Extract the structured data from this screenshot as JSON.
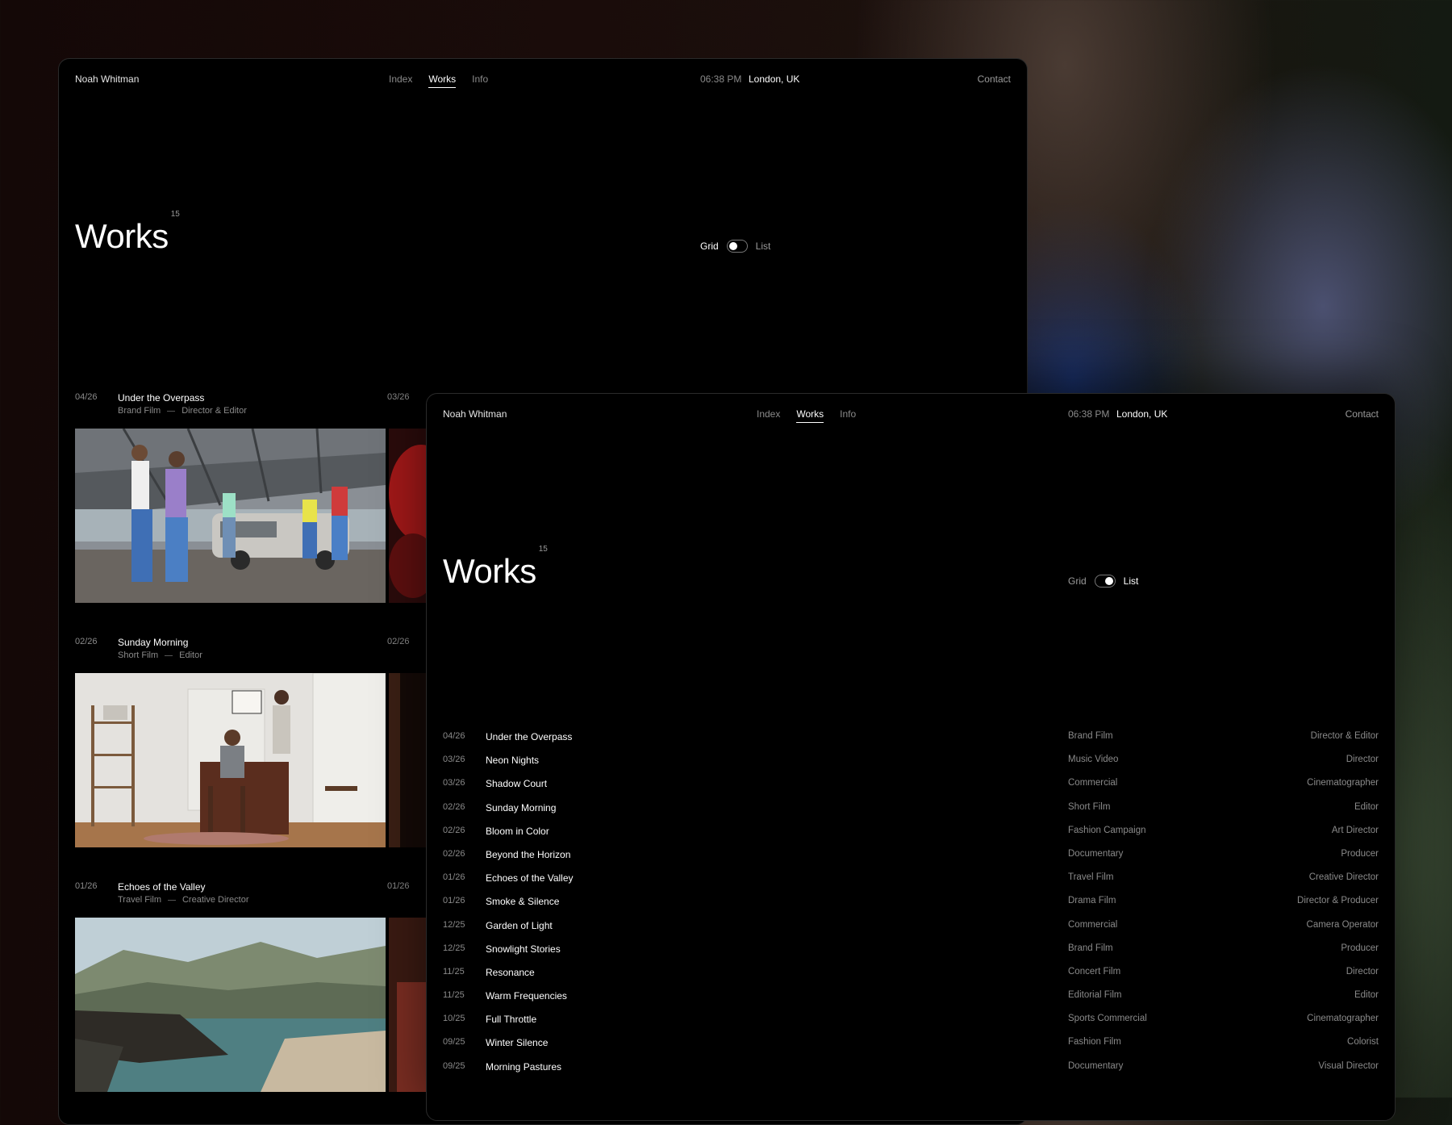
{
  "nav": {
    "brand": "Noah Whitman",
    "links": [
      "Index",
      "Works",
      "Info"
    ],
    "time": "06:38 PM",
    "location": "London, UK",
    "contact": "Contact"
  },
  "page": {
    "title": "Works",
    "count": "15",
    "toggle_grid": "Grid",
    "toggle_list": "List"
  },
  "grid_view": {
    "active_toggle": "Grid",
    "cards": [
      {
        "date": "04/26",
        "title": "Under the Overpass",
        "type": "Brand Film",
        "role": "Director & Editor",
        "next_date": "03/26"
      },
      {
        "date": "02/26",
        "title": "Sunday Morning",
        "type": "Short Film",
        "role": "Editor",
        "next_date": "02/26"
      },
      {
        "date": "01/26",
        "title": "Echoes of the Valley",
        "type": "Travel Film",
        "role": "Creative Director",
        "next_date": "01/26"
      }
    ]
  },
  "list_view": {
    "active_toggle": "List",
    "rows": [
      {
        "date": "04/26",
        "title": "Under the Overpass",
        "type": "Brand Film",
        "role": "Director & Editor"
      },
      {
        "date": "03/26",
        "title": "Neon Nights",
        "type": "Music Video",
        "role": "Director"
      },
      {
        "date": "03/26",
        "title": "Shadow Court",
        "type": "Commercial",
        "role": "Cinematographer"
      },
      {
        "date": "02/26",
        "title": "Sunday Morning",
        "type": "Short Film",
        "role": "Editor"
      },
      {
        "date": "02/26",
        "title": "Bloom in Color",
        "type": "Fashion Campaign",
        "role": "Art Director"
      },
      {
        "date": "02/26",
        "title": "Beyond the Horizon",
        "type": "Documentary",
        "role": "Producer"
      },
      {
        "date": "01/26",
        "title": "Echoes of the Valley",
        "type": "Travel Film",
        "role": "Creative Director"
      },
      {
        "date": "01/26",
        "title": "Smoke & Silence",
        "type": "Drama Film",
        "role": "Director & Producer"
      },
      {
        "date": "12/25",
        "title": "Garden of Light",
        "type": "Commercial",
        "role": "Camera Operator"
      },
      {
        "date": "12/25",
        "title": "Snowlight Stories",
        "type": "Brand Film",
        "role": "Producer"
      },
      {
        "date": "11/25",
        "title": "Resonance",
        "type": "Concert Film",
        "role": "Director"
      },
      {
        "date": "11/25",
        "title": "Warm Frequencies",
        "type": "Editorial Film",
        "role": "Editor"
      },
      {
        "date": "10/25",
        "title": "Full Throttle",
        "type": "Sports Commercial",
        "role": "Cinematographer"
      },
      {
        "date": "09/25",
        "title": "Winter Silence",
        "type": "Fashion Film",
        "role": "Colorist"
      },
      {
        "date": "09/25",
        "title": "Morning Pastures",
        "type": "Documentary",
        "role": "Visual Director"
      }
    ]
  }
}
